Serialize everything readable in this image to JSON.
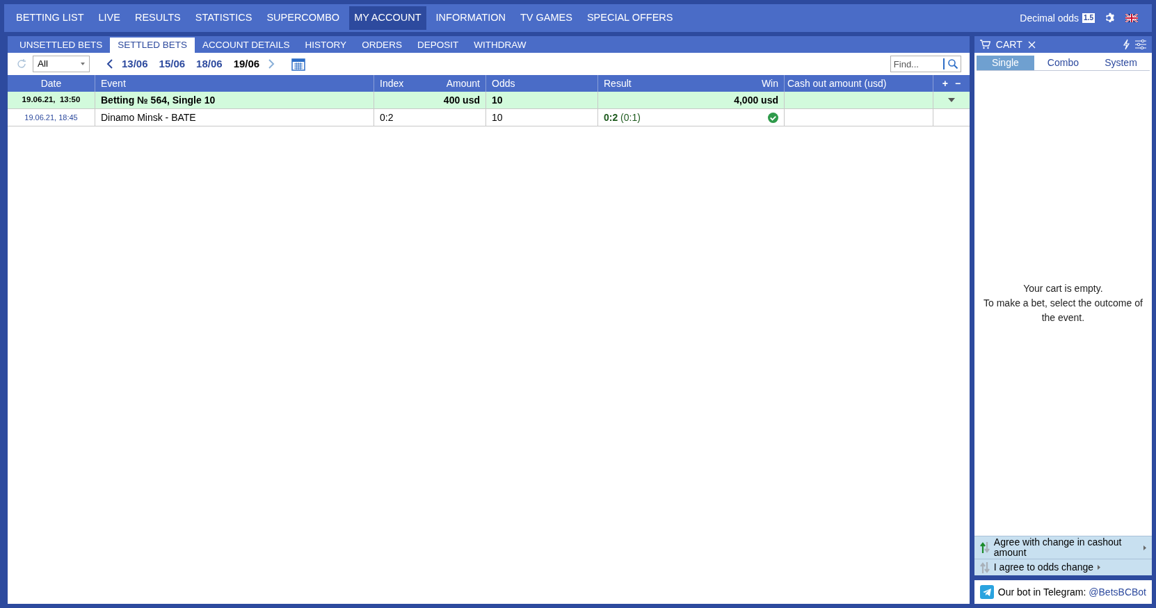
{
  "nav": {
    "items": [
      {
        "label": "BETTING LIST",
        "selected": false
      },
      {
        "label": "LIVE",
        "selected": false
      },
      {
        "label": "RESULTS",
        "selected": false
      },
      {
        "label": "STATISTICS",
        "selected": false
      },
      {
        "label": "SUPERCOMBO",
        "selected": false
      },
      {
        "label": "MY ACCOUNT",
        "selected": true
      },
      {
        "label": "INFORMATION",
        "selected": false
      },
      {
        "label": "TV GAMES",
        "selected": false
      },
      {
        "label": "SPECIAL OFFERS",
        "selected": false
      }
    ],
    "odds_format": "Decimal odds",
    "odds_badge": "1.5"
  },
  "subtabs": [
    {
      "label": "UNSETTLED BETS",
      "selected": false
    },
    {
      "label": "SETTLED BETS",
      "selected": true
    },
    {
      "label": "ACCOUNT DETAILS",
      "selected": false
    },
    {
      "label": "HISTORY",
      "selected": false
    },
    {
      "label": "ORDERS",
      "selected": false
    },
    {
      "label": "DEPOSIT",
      "selected": false
    },
    {
      "label": "WITHDRAW",
      "selected": false
    }
  ],
  "toolbar": {
    "filter": "All",
    "dates": [
      {
        "label": "13/06",
        "selected": false
      },
      {
        "label": "15/06",
        "selected": false
      },
      {
        "label": "18/06",
        "selected": false
      },
      {
        "label": "19/06",
        "selected": true
      }
    ],
    "search": {
      "placeholder": "Find..."
    }
  },
  "table": {
    "columns": {
      "date": "Date",
      "event": "Event",
      "index": "Index",
      "amount": "Amount",
      "odds": "Odds",
      "result": "Result",
      "win": "Win",
      "cashout": "Cash out amount (usd)",
      "expand": "+",
      "collapse": "−"
    },
    "rows": [
      {
        "kind": "bet",
        "date": "19.06.21,  13:50",
        "event": "Betting № 564, Single 10",
        "amount": "400 usd",
        "odds": "10",
        "win": "4,000 usd",
        "expanded": true
      },
      {
        "kind": "event",
        "date": "19.06.21, 18:45",
        "event": "Dinamo Minsk - BATE",
        "index": "0:2",
        "odds": "10",
        "result": "**0:2** (0:1)",
        "won": true
      }
    ]
  },
  "cart": {
    "title": "CART",
    "tabs": [
      {
        "label": "Single",
        "selected": true
      },
      {
        "label": "Combo",
        "selected": false
      },
      {
        "label": "System",
        "selected": false
      }
    ],
    "empty": [
      "Your cart is empty.",
      "To make a bet, select the outcome of the event."
    ],
    "options": [
      {
        "label": "Agree with change in cashout amount",
        "active": true
      },
      {
        "label": "I agree to odds change",
        "active": false
      }
    ],
    "telegram": {
      "text": "Our bot in Telegram:",
      "link": "@BetsBCBot"
    }
  }
}
